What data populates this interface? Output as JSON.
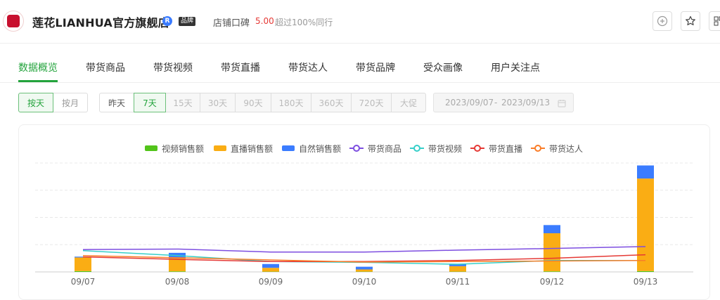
{
  "header": {
    "shop_name": "莲花LIANHUA官方旗舰店",
    "verified_mark": "R",
    "brand_badge": "品牌",
    "reputation_label": "店铺口碑",
    "reputation_score": "5.00",
    "reputation_desc": "超过100%同行",
    "buttons": [
      "add-icon",
      "star-icon",
      "qr-icon"
    ]
  },
  "tabs": {
    "items": [
      "数据概览",
      "带货商品",
      "带货视频",
      "带货直播",
      "带货达人",
      "带货品牌",
      "受众画像",
      "用户关注点"
    ],
    "active": "数据概览"
  },
  "filters": {
    "granularity": [
      "按天",
      "按月"
    ],
    "granularity_active": "按天",
    "periods": [
      "昨天",
      "7天",
      "15天",
      "30天",
      "90天",
      "180天",
      "360天",
      "720天",
      "大促"
    ],
    "period_active": "7天",
    "date_start": "2023/09/07",
    "date_sep": "-",
    "date_end": "2023/09/13"
  },
  "chart_data": {
    "type": "bar",
    "categories": [
      "09/07",
      "09/08",
      "09/09",
      "09/10",
      "09/11",
      "09/12",
      "09/13"
    ],
    "bar_series": [
      {
        "name": "视频销售额",
        "color": "#52c41a",
        "values": [
          3,
          2,
          1,
          1,
          1,
          2,
          3
        ]
      },
      {
        "name": "直播销售额",
        "color": "#faad14",
        "values": [
          50,
          48,
          14,
          8,
          20,
          140,
          340
        ]
      },
      {
        "name": "自然销售额",
        "color": "#3b7cff",
        "values": [
          3,
          20,
          14,
          10,
          9,
          30,
          48
        ]
      }
    ],
    "line_series": [
      {
        "name": "带货商品",
        "color": "#7d4ee0",
        "values": [
          82,
          84,
          73,
          73,
          80,
          86,
          93
        ]
      },
      {
        "name": "带货视频",
        "color": "#36cfc9",
        "values": [
          78,
          60,
          38,
          35,
          28,
          42,
          42
        ]
      },
      {
        "name": "带货直播",
        "color": "#e53935",
        "values": [
          55,
          46,
          38,
          38,
          42,
          50,
          63
        ]
      },
      {
        "name": "带货达人",
        "color": "#fa7d28",
        "values": [
          60,
          52,
          44,
          36,
          38,
          40,
          42
        ]
      }
    ],
    "grid": true,
    "legend_position": "top-center"
  }
}
